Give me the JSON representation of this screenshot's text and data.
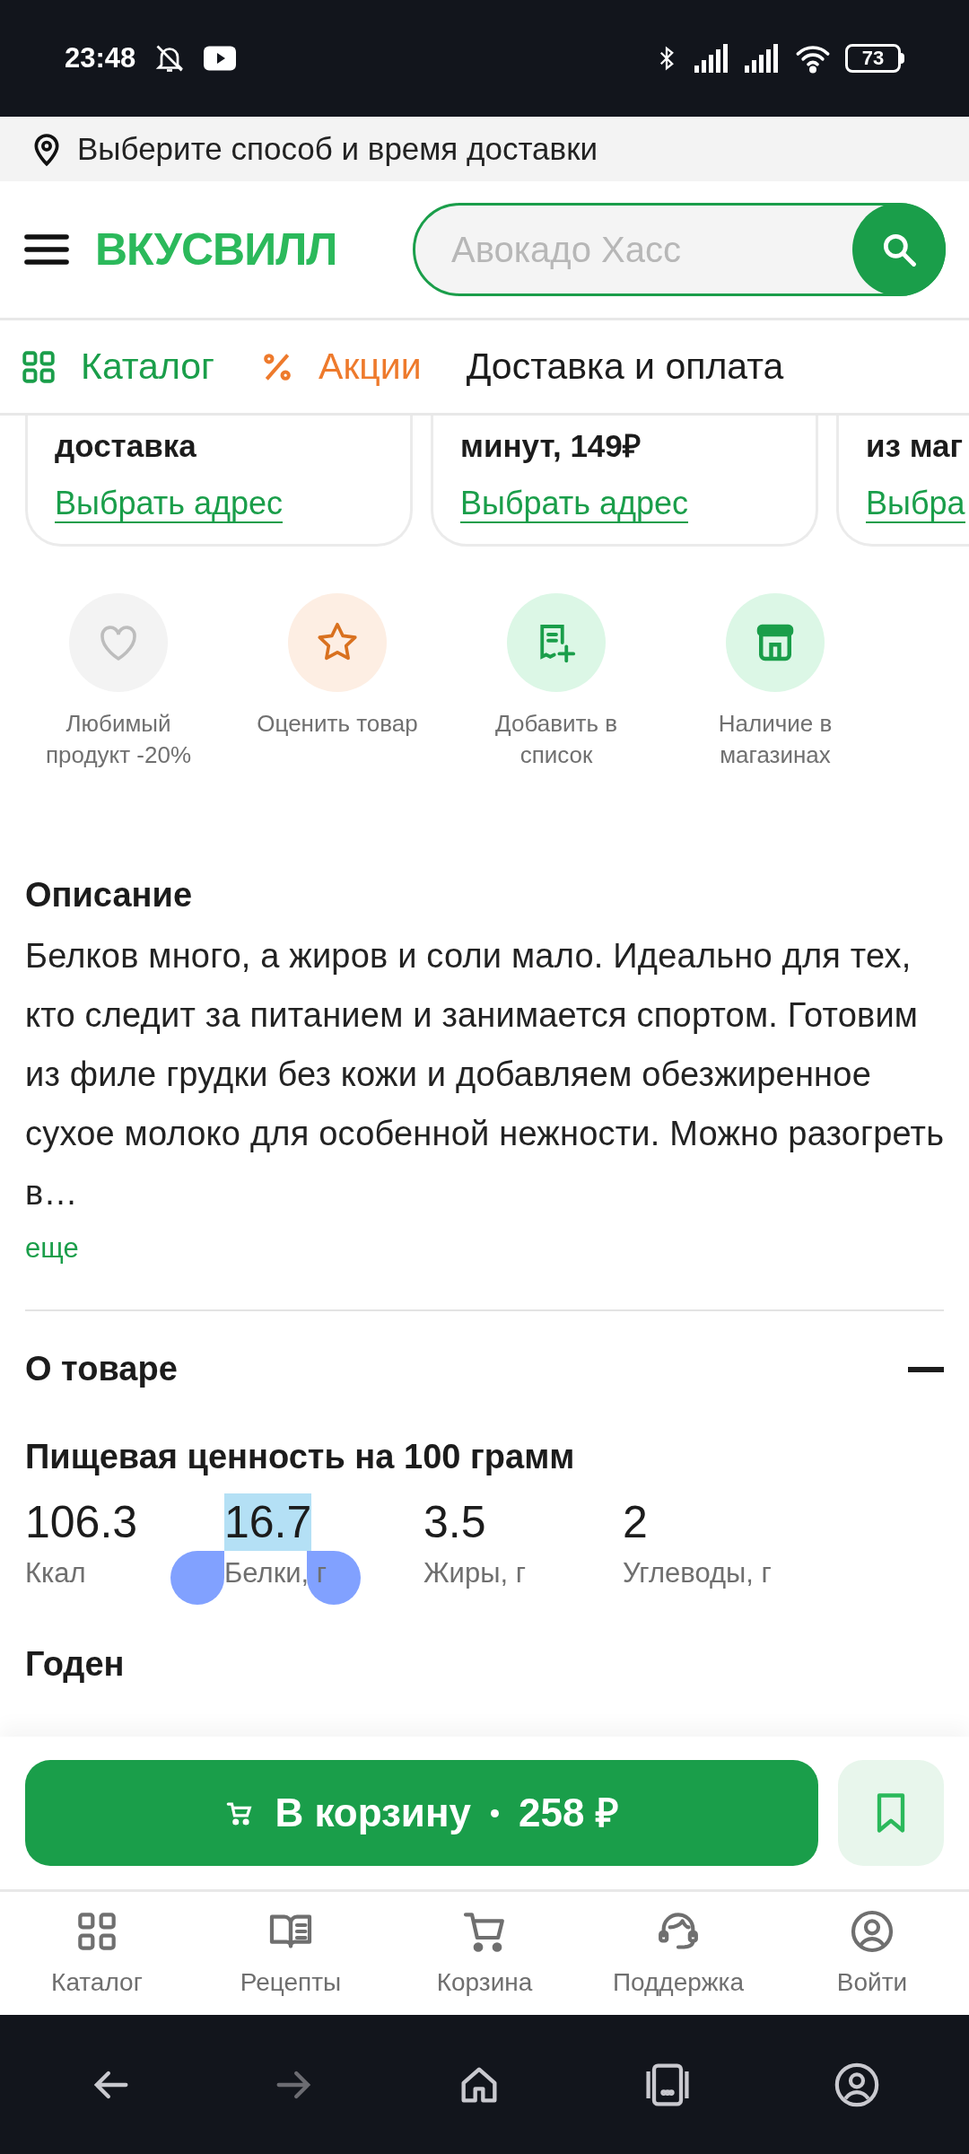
{
  "status_bar": {
    "time": "23:48",
    "battery": "73"
  },
  "delivery_bar": {
    "text": "Выберите способ и время доставки"
  },
  "header": {
    "logo": "ВКУСВИЛЛ",
    "search": {
      "placeholder": "Авокадо Хасс"
    }
  },
  "nav": [
    {
      "label": "Каталог",
      "kind": "catalog"
    },
    {
      "label": "Акции",
      "kind": "promo"
    },
    {
      "label": "Доставка и оплата",
      "kind": "plain"
    }
  ],
  "delivery_cards": [
    {
      "title": "доставка",
      "link": "Выбрать адрес"
    },
    {
      "title": "минут, 149₽",
      "link": "Выбрать адрес"
    },
    {
      "title": "из маг",
      "link": "Выбра"
    }
  ],
  "actions": [
    {
      "kind": "favorite",
      "label": "Любимый продукт -20%"
    },
    {
      "kind": "rate",
      "label": "Оценить товар"
    },
    {
      "kind": "list",
      "label": "Добавить в список"
    },
    {
      "kind": "stores",
      "label": "Наличие в магазинах"
    }
  ],
  "description": {
    "title": "Описание",
    "text": "Белков много, а жиров и соли мало. Идеально для тех, кто следит за питанием и занимается спортом. Готовим из филе грудки без кожи и добавляем обезжиренное сухое молоко для особенной нежности. Можно разогреть в…",
    "more": "еще"
  },
  "about": {
    "title": "О товаре",
    "expanded": true,
    "nutrition_title": "Пищевая ценность на 100 грамм",
    "nutrition": [
      {
        "value": "106.3",
        "label": "Ккал",
        "selected": false
      },
      {
        "value": "16.7",
        "label": "Белки, г",
        "selected": true
      },
      {
        "value": "3.5",
        "label": "Жиры, г",
        "selected": false
      },
      {
        "value": "2",
        "label": "Углеводы, г",
        "selected": false
      }
    ],
    "next_title": "Годен"
  },
  "cart_button": {
    "label": "В корзину",
    "price": "258 ₽"
  },
  "tab_bar": [
    {
      "kind": "catalog",
      "label": "Каталог"
    },
    {
      "kind": "recipes",
      "label": "Рецепты"
    },
    {
      "kind": "cart",
      "label": "Корзина"
    },
    {
      "kind": "support",
      "label": "Поддержка"
    },
    {
      "kind": "login",
      "label": "Войти"
    }
  ]
}
